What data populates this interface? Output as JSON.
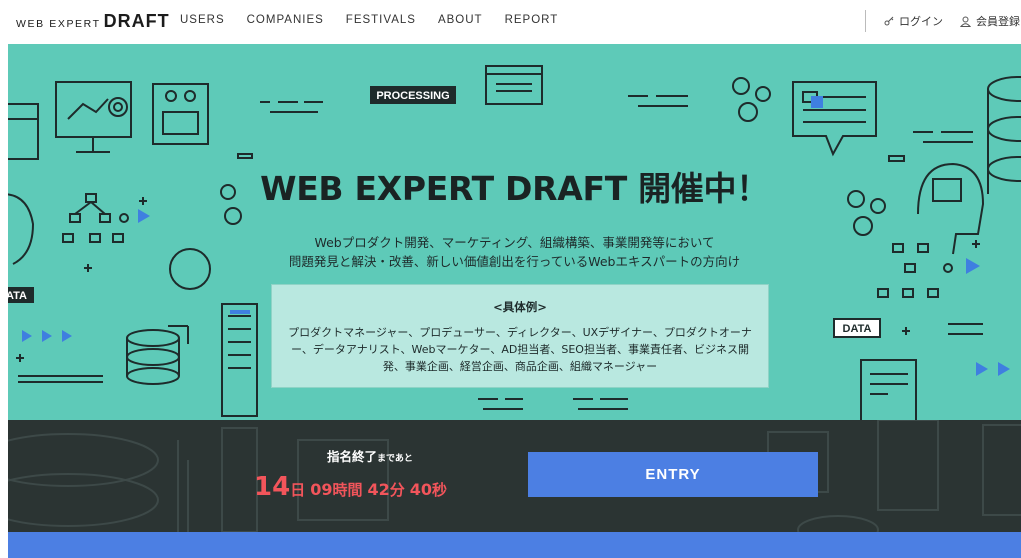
{
  "header": {
    "logo_small": "WEB EXPERT",
    "logo_big": "DRAFT",
    "nav": [
      "USERS",
      "COMPANIES",
      "FESTIVALS",
      "ABOUT",
      "REPORT"
    ],
    "login": "ログイン",
    "register": "会員登録"
  },
  "hero": {
    "title": "WEB EXPERT DRAFT 開催中！",
    "description_line1": "Webプロダクト開発、マーケティング、組織構築、事業開発等において",
    "description_line2": "問題発見と解決・改善、新しい価値創出を行っているWebエキスパートの方向け",
    "examples_title": "<具体例>",
    "examples_text": "プロダクトマネージャー、プロデューサー、ディレクター、UXデザイナー、プロダクトオーナー、データアナリスト、Webマーケター、AD担当者、SEO担当者、事業責任者、ビジネス開発、事業企画、経営企画、商品企画、組織マネージャー",
    "decor_labels": {
      "processing": "PROCESSING",
      "data_left": "ATA",
      "data_right": "DATA"
    }
  },
  "countdown": {
    "label_main": "指名終了",
    "label_small": "まであと",
    "days": "14",
    "days_unit": "日",
    "hours": "09",
    "hours_unit": "時間",
    "minutes": "42",
    "minutes_unit": "分",
    "seconds": "40",
    "seconds_unit": "秒"
  },
  "entry_button": "ENTRY",
  "colors": {
    "hero_bg": "#5ecab8",
    "band_bg": "#2b3433",
    "accent_blue": "#4c7fe3",
    "countdown_red": "#f2555b"
  }
}
